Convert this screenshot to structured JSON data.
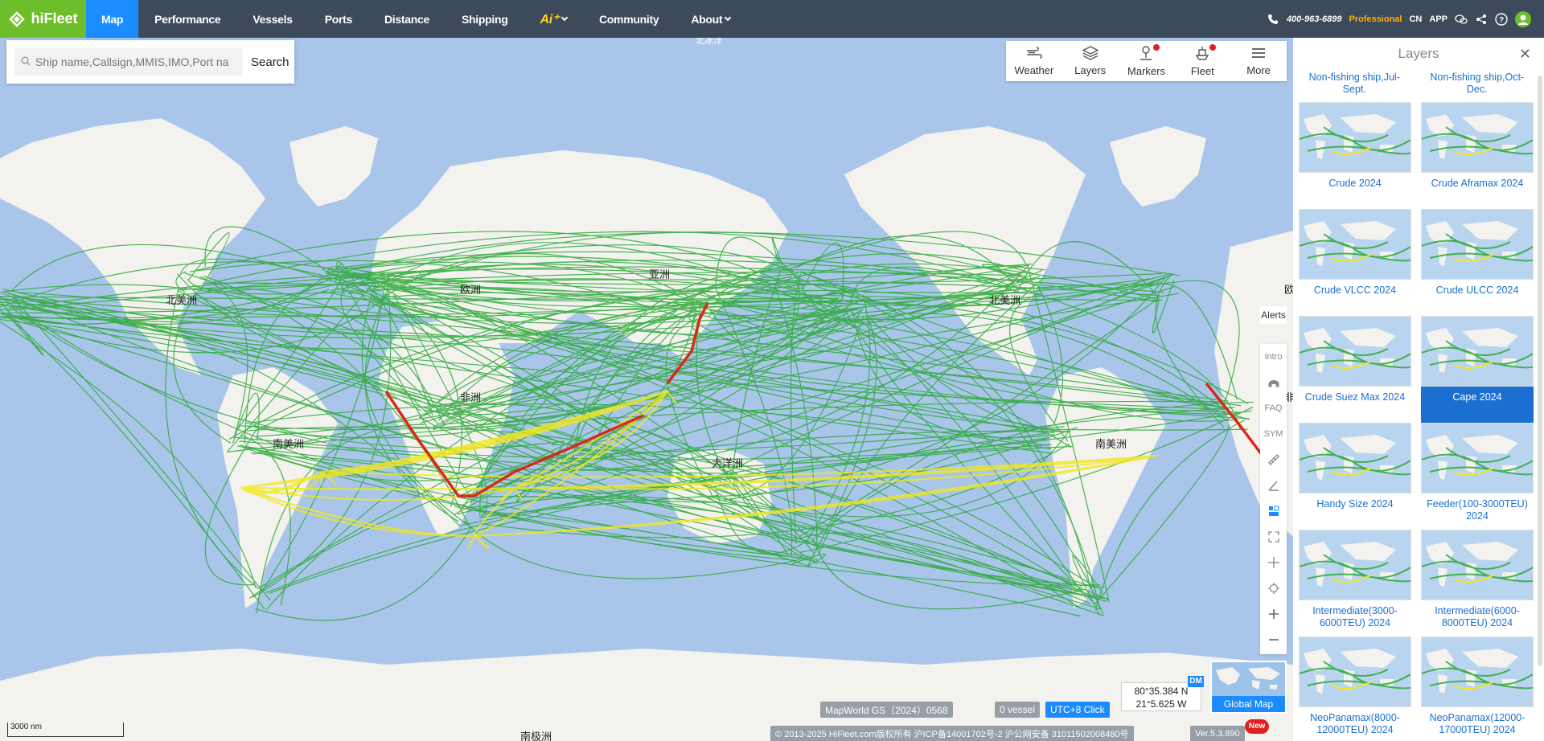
{
  "brand": {
    "name": "hiFleet"
  },
  "nav": {
    "items": [
      {
        "label": "Map",
        "active": true
      },
      {
        "label": "Performance"
      },
      {
        "label": "Vessels"
      },
      {
        "label": "Ports"
      },
      {
        "label": "Distance"
      },
      {
        "label": "Shipping"
      },
      {
        "label": "Ai⁺"
      },
      {
        "label": "Community"
      },
      {
        "label": "About"
      }
    ]
  },
  "header": {
    "phone": "400-963-6899",
    "plan": "Professional",
    "lang": "CN",
    "app": "APP"
  },
  "search": {
    "placeholder": "Ship name,Callsign,MMIS,IMO,Port na",
    "button": "Search"
  },
  "toolbar": {
    "items": [
      {
        "label": "Weather",
        "icon": "wind-icon"
      },
      {
        "label": "Layers",
        "icon": "layers-icon"
      },
      {
        "label": "Markers",
        "icon": "marker-pin-icon",
        "dot": true
      },
      {
        "label": "Fleet",
        "icon": "ship-icon",
        "dot": true
      },
      {
        "label": "More",
        "icon": "menu-icon"
      }
    ]
  },
  "side_tools": {
    "alerts": "Alerts",
    "intro": "Intro",
    "faq": "FAQ",
    "sym": "SYM"
  },
  "map": {
    "labels": {
      "north_america_1": "北美洲",
      "europe_1": "欧洲",
      "asia": "亚洲",
      "africa": "非洲",
      "south_america_1": "南美洲",
      "oceania": "大洋洲",
      "north_america_2": "北美洲",
      "europe_2": "欧",
      "africa_2": "非",
      "south_america_2": "南美洲",
      "antarctica": "南极洲",
      "arctic": "北冰洋"
    },
    "scale": "3000 nm",
    "source": "MapWorld GS（2024）0568",
    "vessels": "0 vessel",
    "timezone": "UTC+8 Click",
    "coord_lat": "80°35.384 N",
    "coord_lon": "21°5.625 W",
    "coord_mode": "DM",
    "global_map": "Global Map",
    "copyright": "© 2013-2025 HiFleet.com版权所有 沪ICP备14001702号-2 沪公网安备 31011502008480号",
    "version": "Ver.5.3.890",
    "new_badge": "New"
  },
  "layers_panel": {
    "title": "Layers",
    "top_labels": [
      "Non-fishing ship,Jul-Sept.",
      "Non-fishing ship,Oct-Dec."
    ],
    "cards": [
      {
        "label": "Crude 2024"
      },
      {
        "label": "Crude Aframax 2024"
      },
      {
        "label": "Crude VLCC 2024"
      },
      {
        "label": "Crude ULCC 2024"
      },
      {
        "label": "Crude Suez Max 2024"
      },
      {
        "label": "Cape 2024",
        "selected": true
      },
      {
        "label": "Handy Size 2024"
      },
      {
        "label": "Feeder(100-3000TEU) 2024"
      },
      {
        "label": "Intermediate(3000-6000TEU) 2024"
      },
      {
        "label": "Intermediate(6000-8000TEU) 2024"
      },
      {
        "label": "NeoPanamax(8000-12000TEU) 2024"
      },
      {
        "label": "NeoPanamax(12000-17000TEU) 2024"
      }
    ]
  },
  "colors": {
    "nav_bg": "#3c4a5c",
    "brand_green": "#6cbf2b",
    "active_blue": "#1a8cff",
    "ocean": "#a9c6ea",
    "land": "#f3f2ee",
    "route_green": "#2ca838",
    "route_yellow": "#f2e81a",
    "route_red": "#d82a1a"
  }
}
